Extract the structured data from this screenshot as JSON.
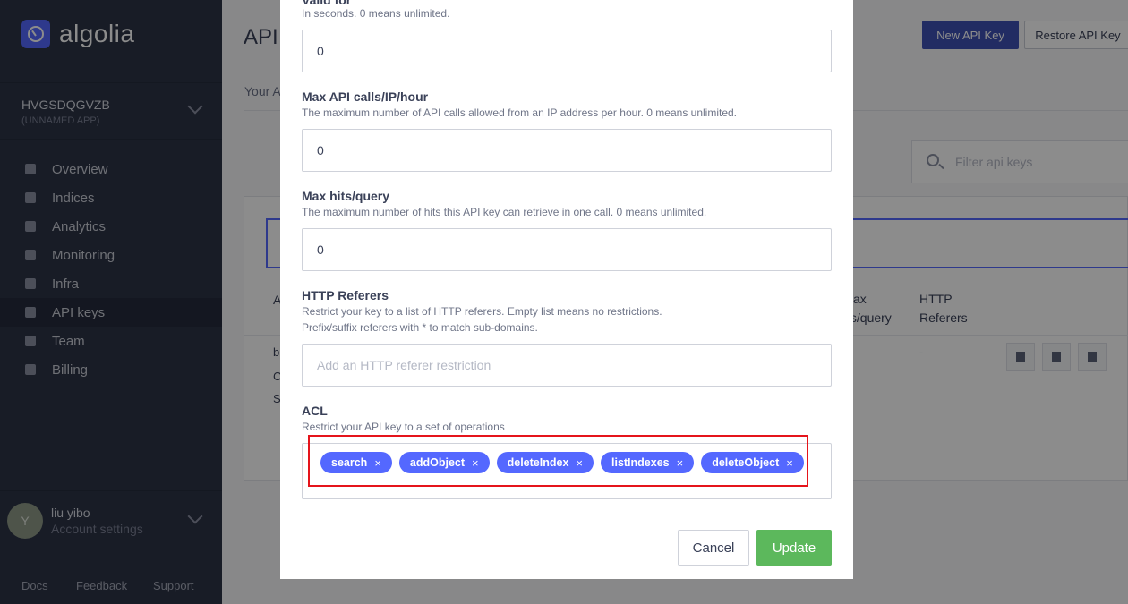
{
  "sidebar": {
    "logo_text": "algolia",
    "app_id": "HVGSDQGVZB",
    "app_name": "(UNNAMED APP)",
    "items": [
      {
        "label": "Overview",
        "icon": "dashboard-icon"
      },
      {
        "label": "Indices",
        "icon": "database-icon"
      },
      {
        "label": "Analytics",
        "icon": "chart-icon"
      },
      {
        "label": "Monitoring",
        "icon": "monitor-icon"
      },
      {
        "label": "Infra",
        "icon": "globe-icon"
      },
      {
        "label": "API keys",
        "icon": "key-icon",
        "active": true
      },
      {
        "label": "Team",
        "icon": "team-icon"
      },
      {
        "label": "Billing",
        "icon": "billing-icon"
      }
    ],
    "user": {
      "initial": "Y",
      "name": "liu yibo",
      "sub": "Account settings"
    },
    "footer": {
      "docs": "Docs",
      "feedback": "Feedback",
      "support": "Support"
    }
  },
  "main": {
    "title": "API",
    "new_key_label": "New API Key",
    "restore_key_label": "Restore API Key",
    "subtab": "Your A",
    "filter_placeholder": "Filter api keys",
    "columns": {
      "a": "A",
      "max": "ax",
      "max2": "ts/query",
      "http": "HTTP",
      "http2": "Referers"
    },
    "row": {
      "c1": "b",
      "c2": "C",
      "c3": "S",
      "referers": "-"
    }
  },
  "modal": {
    "validity_label": "Valid for",
    "validity_help": "In seconds. 0 means unlimited.",
    "validity_value": "0",
    "maxcalls_label": "Max API calls/IP/hour",
    "maxcalls_help": "The maximum number of API calls allowed from an IP address per hour. 0 means unlimited.",
    "maxcalls_value": "0",
    "maxhits_label": "Max hits/query",
    "maxhits_help": "The maximum number of hits this API key can retrieve in one call. 0 means unlimited.",
    "maxhits_value": "0",
    "referers_label": "HTTP Referers",
    "referers_help1": "Restrict your key to a list of HTTP referers. Empty list means no restrictions.",
    "referers_help2": "Prefix/suffix referers with * to match sub-domains.",
    "referers_placeholder": "Add an HTTP referer restriction",
    "acl_label": "ACL",
    "acl_help": "Restrict your API key to a set of operations",
    "acl_tags": [
      "search",
      "addObject",
      "deleteIndex",
      "listIndexes",
      "deleteObject"
    ],
    "tag_remove": "×",
    "cancel_label": "Cancel",
    "update_label": "Update"
  },
  "colors": {
    "accent": "#5468ff",
    "sidebar": "#2c3346",
    "update": "#5cb85c",
    "highlight": "#e5141b"
  }
}
